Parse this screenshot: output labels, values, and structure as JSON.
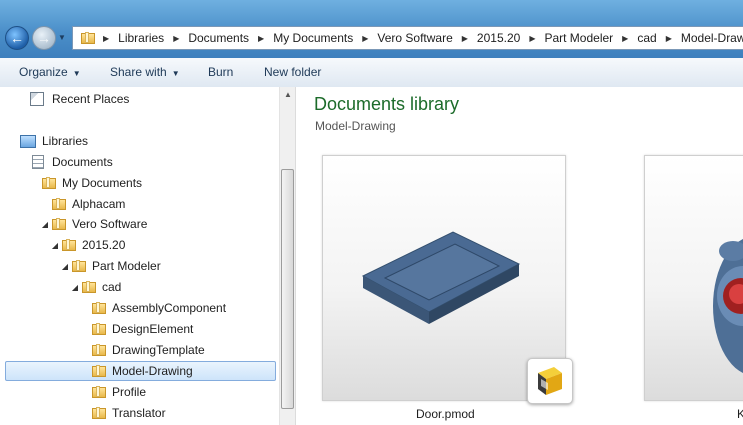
{
  "breadcrumb": [
    "Libraries",
    "Documents",
    "My Documents",
    "Vero Software",
    "2015.20",
    "Part Modeler",
    "cad",
    "Model-Drawing"
  ],
  "toolbar": {
    "organize": "Organize",
    "share_with": "Share with",
    "burn": "Burn",
    "new_folder": "New folder"
  },
  "nav": {
    "recent_places": "Recent Places",
    "libraries": "Libraries",
    "documents": "Documents",
    "my_documents": "My Documents",
    "alphacam": "Alphacam",
    "vero_software": "Vero Software",
    "version": "2015.20",
    "part_modeler": "Part Modeler",
    "cad": "cad",
    "assembly_component": "AssemblyComponent",
    "design_element": "DesignElement",
    "drawing_template": "DrawingTemplate",
    "model_drawing": "Model-Drawing",
    "profile": "Profile",
    "translator": "Translator"
  },
  "library": {
    "title": "Documents library",
    "subtitle": "Model-Drawing"
  },
  "files": [
    {
      "name": "Door.pmod",
      "icon": "part-modeler-file-icon"
    },
    {
      "name": "K",
      "icon": "part-modeler-file-icon"
    }
  ]
}
